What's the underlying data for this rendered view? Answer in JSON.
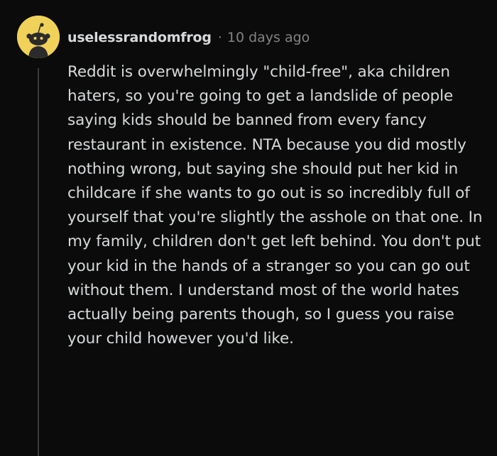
{
  "comment": {
    "avatar_icon": "snoo-avatar-icon",
    "avatar_color": "#f0d15a",
    "username": "uselessrandomfrog",
    "separator": "·",
    "timestamp": "10 days ago",
    "text": "Reddit is overwhelmingly \"child-free\", aka children haters, so you're going to get a landslide of people saying kids should be banned from every fancy restaurant in existence. NTA because you did mostly nothing wrong, but saying she should put her kid in childcare if she wants to go out is so incredibly full of yourself that you're slightly the asshole on that one. In my family, children don't get left behind. You don't put your kid in the hands of a stranger so you can go out without them. I understand most of the world hates actually being parents though, so I guess you raise your child however you'd like."
  }
}
